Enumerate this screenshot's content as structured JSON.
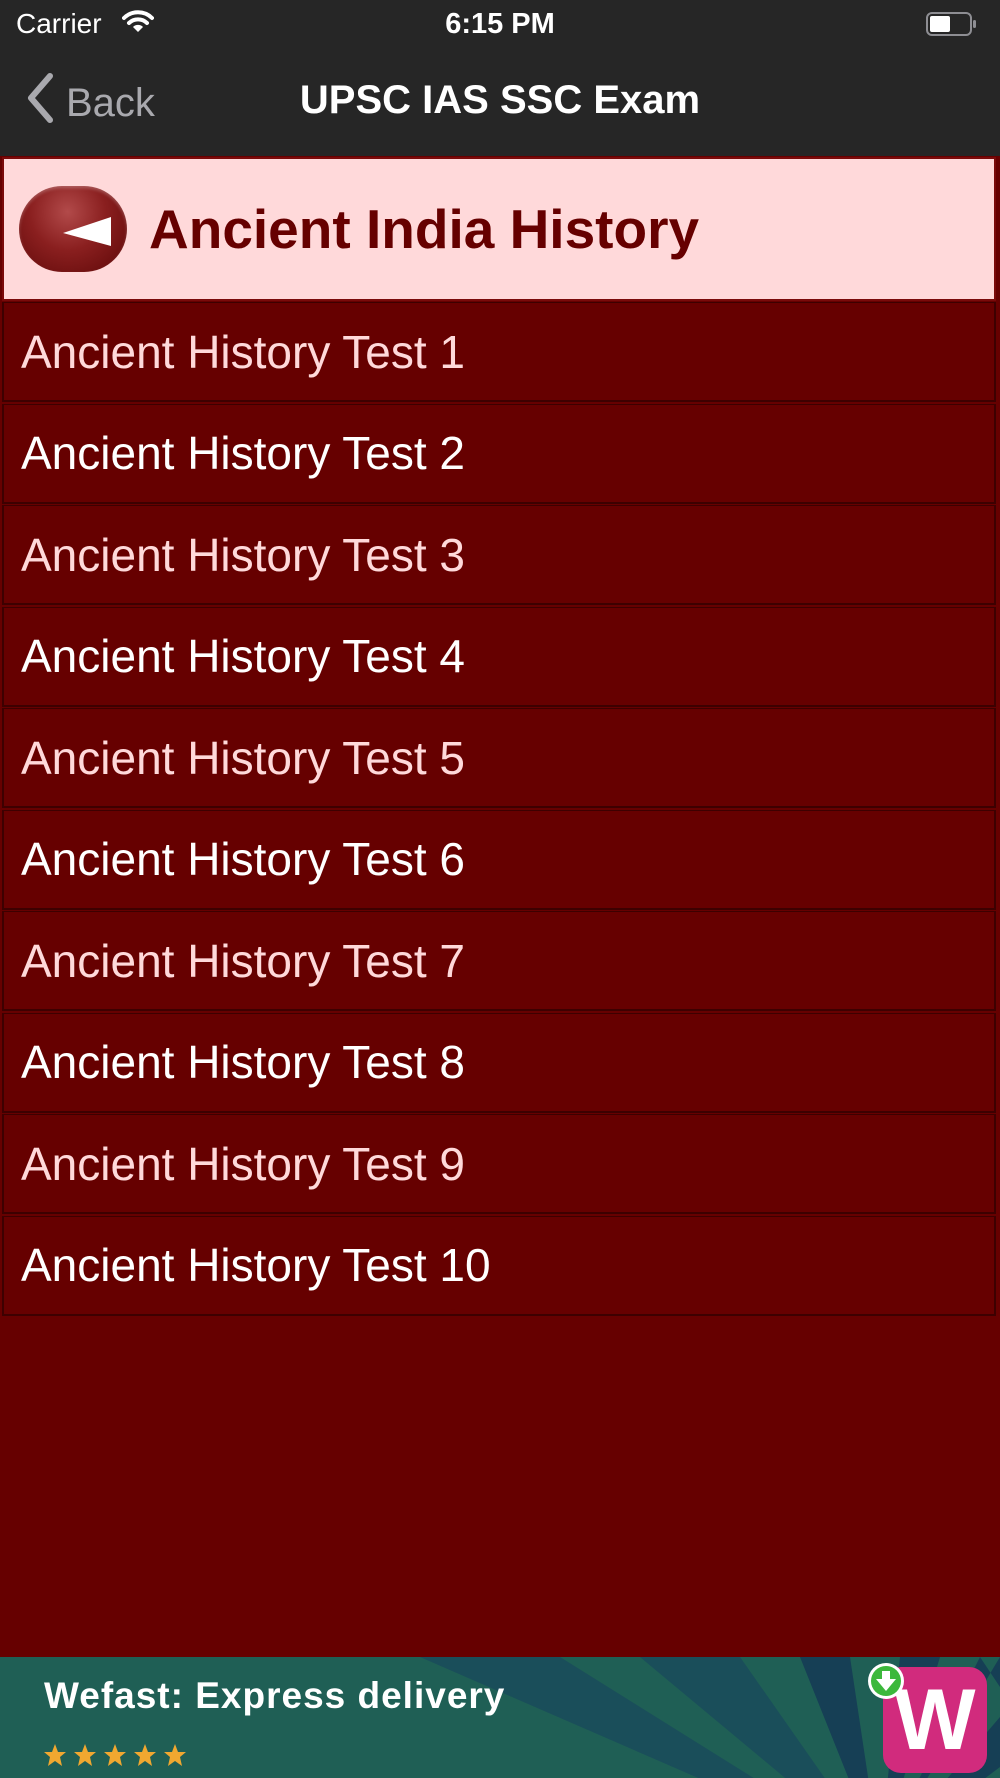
{
  "status_bar": {
    "carrier": "Carrier",
    "time": "6:15 PM",
    "icons": [
      "wifi-icon",
      "battery-icon"
    ]
  },
  "nav": {
    "back_label": "Back",
    "title": "UPSC IAS SSC Exam",
    "icon": "chevron-left-icon"
  },
  "header": {
    "title": "Ancient India History",
    "back_icon": "back-arrow-icon"
  },
  "tests": [
    {
      "label": "Ancient History Test 1"
    },
    {
      "label": "Ancient History Test 2"
    },
    {
      "label": "Ancient History Test 3"
    },
    {
      "label": "Ancient History Test 4"
    },
    {
      "label": "Ancient History Test 5"
    },
    {
      "label": "Ancient History Test 6"
    },
    {
      "label": "Ancient History Test 7"
    },
    {
      "label": "Ancient History Test 8"
    },
    {
      "label": "Ancient History Test 9"
    },
    {
      "label": "Ancient History Test 10"
    }
  ],
  "ad": {
    "title": "Wefast: Express delivery",
    "rating_stars": 5,
    "logo_letter": "W",
    "icons": [
      "star-icon",
      "download-icon"
    ]
  },
  "colors": {
    "background": "#660000",
    "header_bg": "#ffd9da",
    "header_text": "#660000",
    "nav_bg": "#262626",
    "list_text_light": "#ffd9da",
    "list_text_white": "#ffffff",
    "ad_bg": "#1f5f55",
    "ad_logo": "#d12b7d"
  }
}
